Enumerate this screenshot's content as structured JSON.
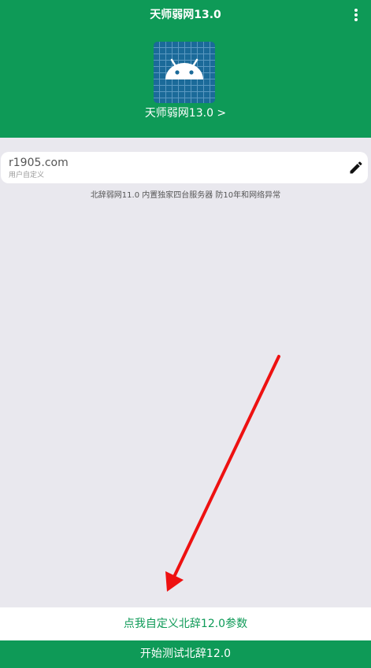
{
  "header": {
    "title": "天师弱网13.0",
    "menu_icon": "more-vert-icon",
    "app_icon": "android-icon",
    "app_link": "天师弱网13.0 >"
  },
  "server": {
    "value": "r1905.com",
    "caption": "用户自定义",
    "edit_icon": "edit-pencil-icon"
  },
  "info": {
    "text": "北辞弱网11.0 内置独家四台服务器 防10年和网络异常"
  },
  "buttons": {
    "customize_label": "点我自定义北辞12.0参数",
    "start_label": "开始测试北辞12.0"
  },
  "colors": {
    "primary": "#0e9a57",
    "background": "#e9e8ee",
    "icon_blue": "#1b6a99",
    "annotation_red": "#ee1111"
  }
}
